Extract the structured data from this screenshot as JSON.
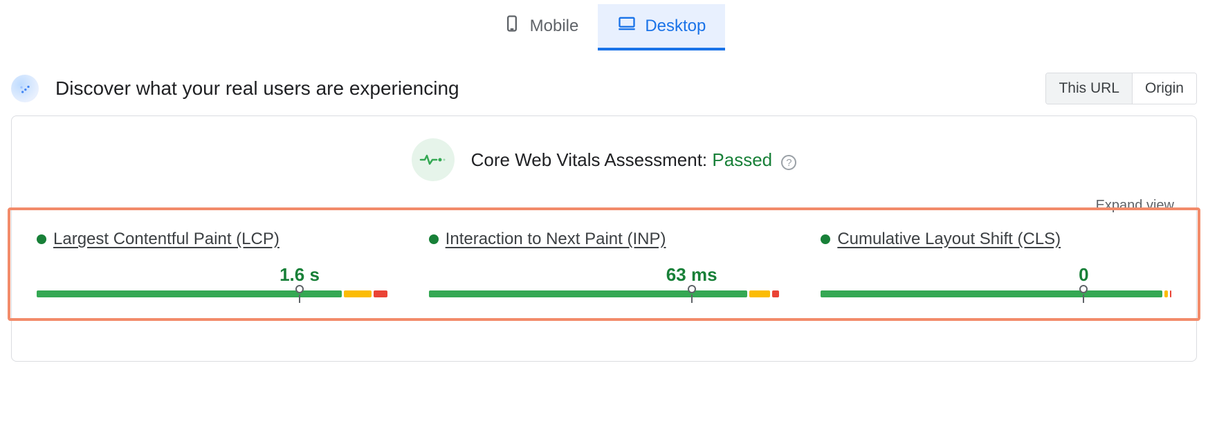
{
  "tabs": {
    "mobile": "Mobile",
    "desktop": "Desktop",
    "active": "desktop"
  },
  "section": {
    "title": "Discover what your real users are experiencing"
  },
  "scope_toggle": {
    "this_url": "This URL",
    "origin": "Origin",
    "active": "this_url"
  },
  "assessment": {
    "label": "Core Web Vitals Assessment: ",
    "result": "Passed"
  },
  "expand_view": "Expand view",
  "metrics": [
    {
      "name": "Largest Contentful Paint (LCP)",
      "value": "1.6 s",
      "marker_pct": 75,
      "segments": [
        {
          "color": "green",
          "pct": 88
        },
        {
          "color": "orange",
          "pct": 8
        },
        {
          "color": "red",
          "pct": 4
        }
      ]
    },
    {
      "name": "Interaction to Next Paint (INP)",
      "value": "63 ms",
      "marker_pct": 75,
      "segments": [
        {
          "color": "green",
          "pct": 92
        },
        {
          "color": "orange",
          "pct": 6
        },
        {
          "color": "red",
          "pct": 2
        }
      ]
    },
    {
      "name": "Cumulative Layout Shift (CLS)",
      "value": "0",
      "marker_pct": 75,
      "segments": [
        {
          "color": "green",
          "pct": 98.5
        },
        {
          "color": "orange",
          "pct": 1
        },
        {
          "color": "red",
          "pct": 0.5
        }
      ]
    }
  ],
  "colors": {
    "accent": "#1a73e8",
    "pass": "#188038",
    "highlight_border": "#f28b6a"
  }
}
